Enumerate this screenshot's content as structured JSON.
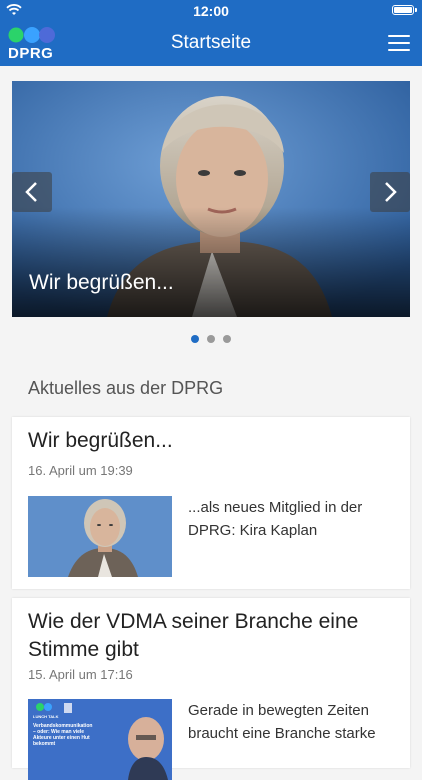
{
  "status": {
    "time": "12:00"
  },
  "header": {
    "logo_text": "DPRG",
    "title": "Startseite"
  },
  "slider": {
    "caption": "Wir begrüßen...",
    "slide_count": 3,
    "active_index": 0
  },
  "section": {
    "title": "Aktuelles aus der DPRG"
  },
  "articles": [
    {
      "title": "Wir begrüßen...",
      "date": "16. April um 19:39",
      "excerpt": "...als neues Mitglied in der DPRG: Kira Kaplan"
    },
    {
      "title": "Wie der VDMA seiner Branche eine Stimme gibt",
      "date": "15. April um 17:16",
      "excerpt": "Gerade in bewegten Zeiten braucht eine Branche starke",
      "thumb_text": "Verbandskommunikation – oder: Wie man viele Akteure unter einen Hut bekommt",
      "thumb_badge": "LUNCH TALK"
    }
  ],
  "colors": {
    "brand": "#1f6cc4",
    "dot_inactive": "#9a9a9a"
  }
}
